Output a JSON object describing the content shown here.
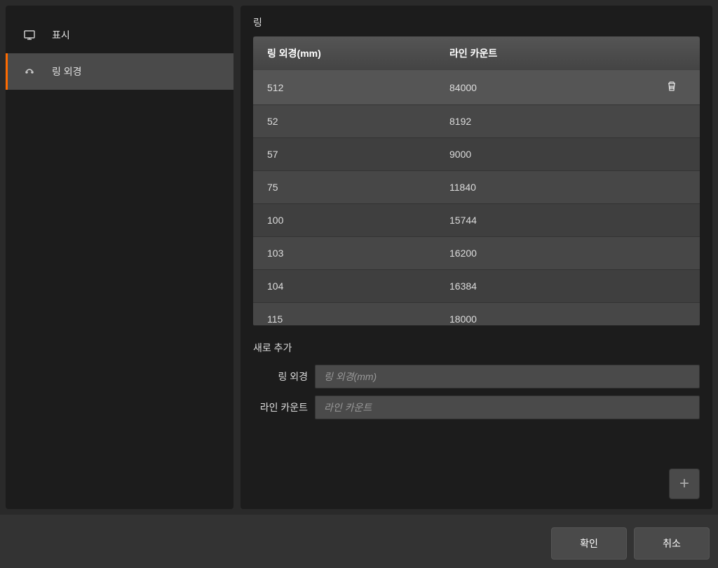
{
  "sidebar": {
    "items": [
      {
        "label": "표시"
      },
      {
        "label": "링 외경"
      }
    ]
  },
  "content": {
    "title": "링",
    "table": {
      "headers": {
        "diameter": "링 외경(mm)",
        "count": "라인 카운트"
      },
      "rows": [
        {
          "diameter": "512",
          "count": "84000"
        },
        {
          "diameter": "52",
          "count": "8192"
        },
        {
          "diameter": "57",
          "count": "9000"
        },
        {
          "diameter": "75",
          "count": "11840"
        },
        {
          "diameter": "100",
          "count": "15744"
        },
        {
          "diameter": "103",
          "count": "16200"
        },
        {
          "diameter": "104",
          "count": "16384"
        },
        {
          "diameter": "115",
          "count": "18000"
        }
      ]
    },
    "add_section": {
      "title": "새로 추가",
      "diameter_label": "링 외경",
      "diameter_placeholder": "링 외경(mm)",
      "count_label": "라인 카운트",
      "count_placeholder": "라인 카운트"
    }
  },
  "footer": {
    "ok": "확인",
    "cancel": "취소"
  }
}
